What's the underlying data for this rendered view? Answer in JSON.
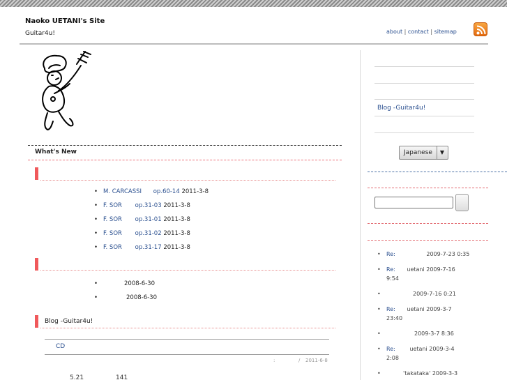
{
  "header": {
    "title": "Naoko UETANI's Site",
    "subtitle": "Guitar4u!",
    "links": [
      "about",
      "contact",
      "sitemap"
    ],
    "separator": " | ",
    "rss_icon": "rss-icon"
  },
  "main": {
    "whats_new": "What's New",
    "section1": {
      "items": [
        {
          "composer": "M. CARCASSI",
          "opus": "op.60-14",
          "date": "2011-3-8"
        },
        {
          "composer": "F. SOR",
          "opus": "op.31-03",
          "date": "2011-3-8"
        },
        {
          "composer": "F. SOR",
          "opus": "op.31-01",
          "date": "2011-3-8"
        },
        {
          "composer": "F. SOR",
          "opus": "op.31-02",
          "date": "2011-3-8"
        },
        {
          "composer": "F. SOR",
          "opus": "op.31-17",
          "date": "2011-3-8"
        }
      ]
    },
    "section2": {
      "items": [
        "2008-6-30",
        "2008-6-30"
      ]
    },
    "section3": {
      "label": "Blog -Guitar4u!",
      "post_title": "CD",
      "meta_sep1": ":",
      "meta_sep2": "/",
      "post_date": "2011-6-8",
      "partial_a": "5.21",
      "partial_b": "141"
    }
  },
  "sidebar": {
    "blog_link": "Blog -Guitar4u!",
    "language": "Japanese",
    "dropdown_arrow": "▼",
    "comments": [
      {
        "re": "Re:",
        "author": "",
        "date": "2009-7-23 0:35",
        "date2": ""
      },
      {
        "re": "Re:",
        "author": "uetani",
        "date": "2009-7-16",
        "date2": "9:54"
      },
      {
        "re": "",
        "author": "",
        "date": "2009-7-16 0:21",
        "date2": ""
      },
      {
        "re": "Re:",
        "author": "uetani",
        "date": "2009-3-7",
        "date2": "23:40"
      },
      {
        "re": "",
        "author": "",
        "date": "2009-3-7 8:36",
        "date2": ""
      },
      {
        "re": "Re:",
        "author": "uetani",
        "date": "2009-3-4",
        "date2": "2:08"
      },
      {
        "re": "",
        "author": "'takataka'",
        "date": "2009-3-3",
        "date2": ""
      }
    ]
  },
  "colors": {
    "accent_red": "#f0595b",
    "link_blue": "#2a4f8f",
    "rss_orange": "#f08a24"
  }
}
